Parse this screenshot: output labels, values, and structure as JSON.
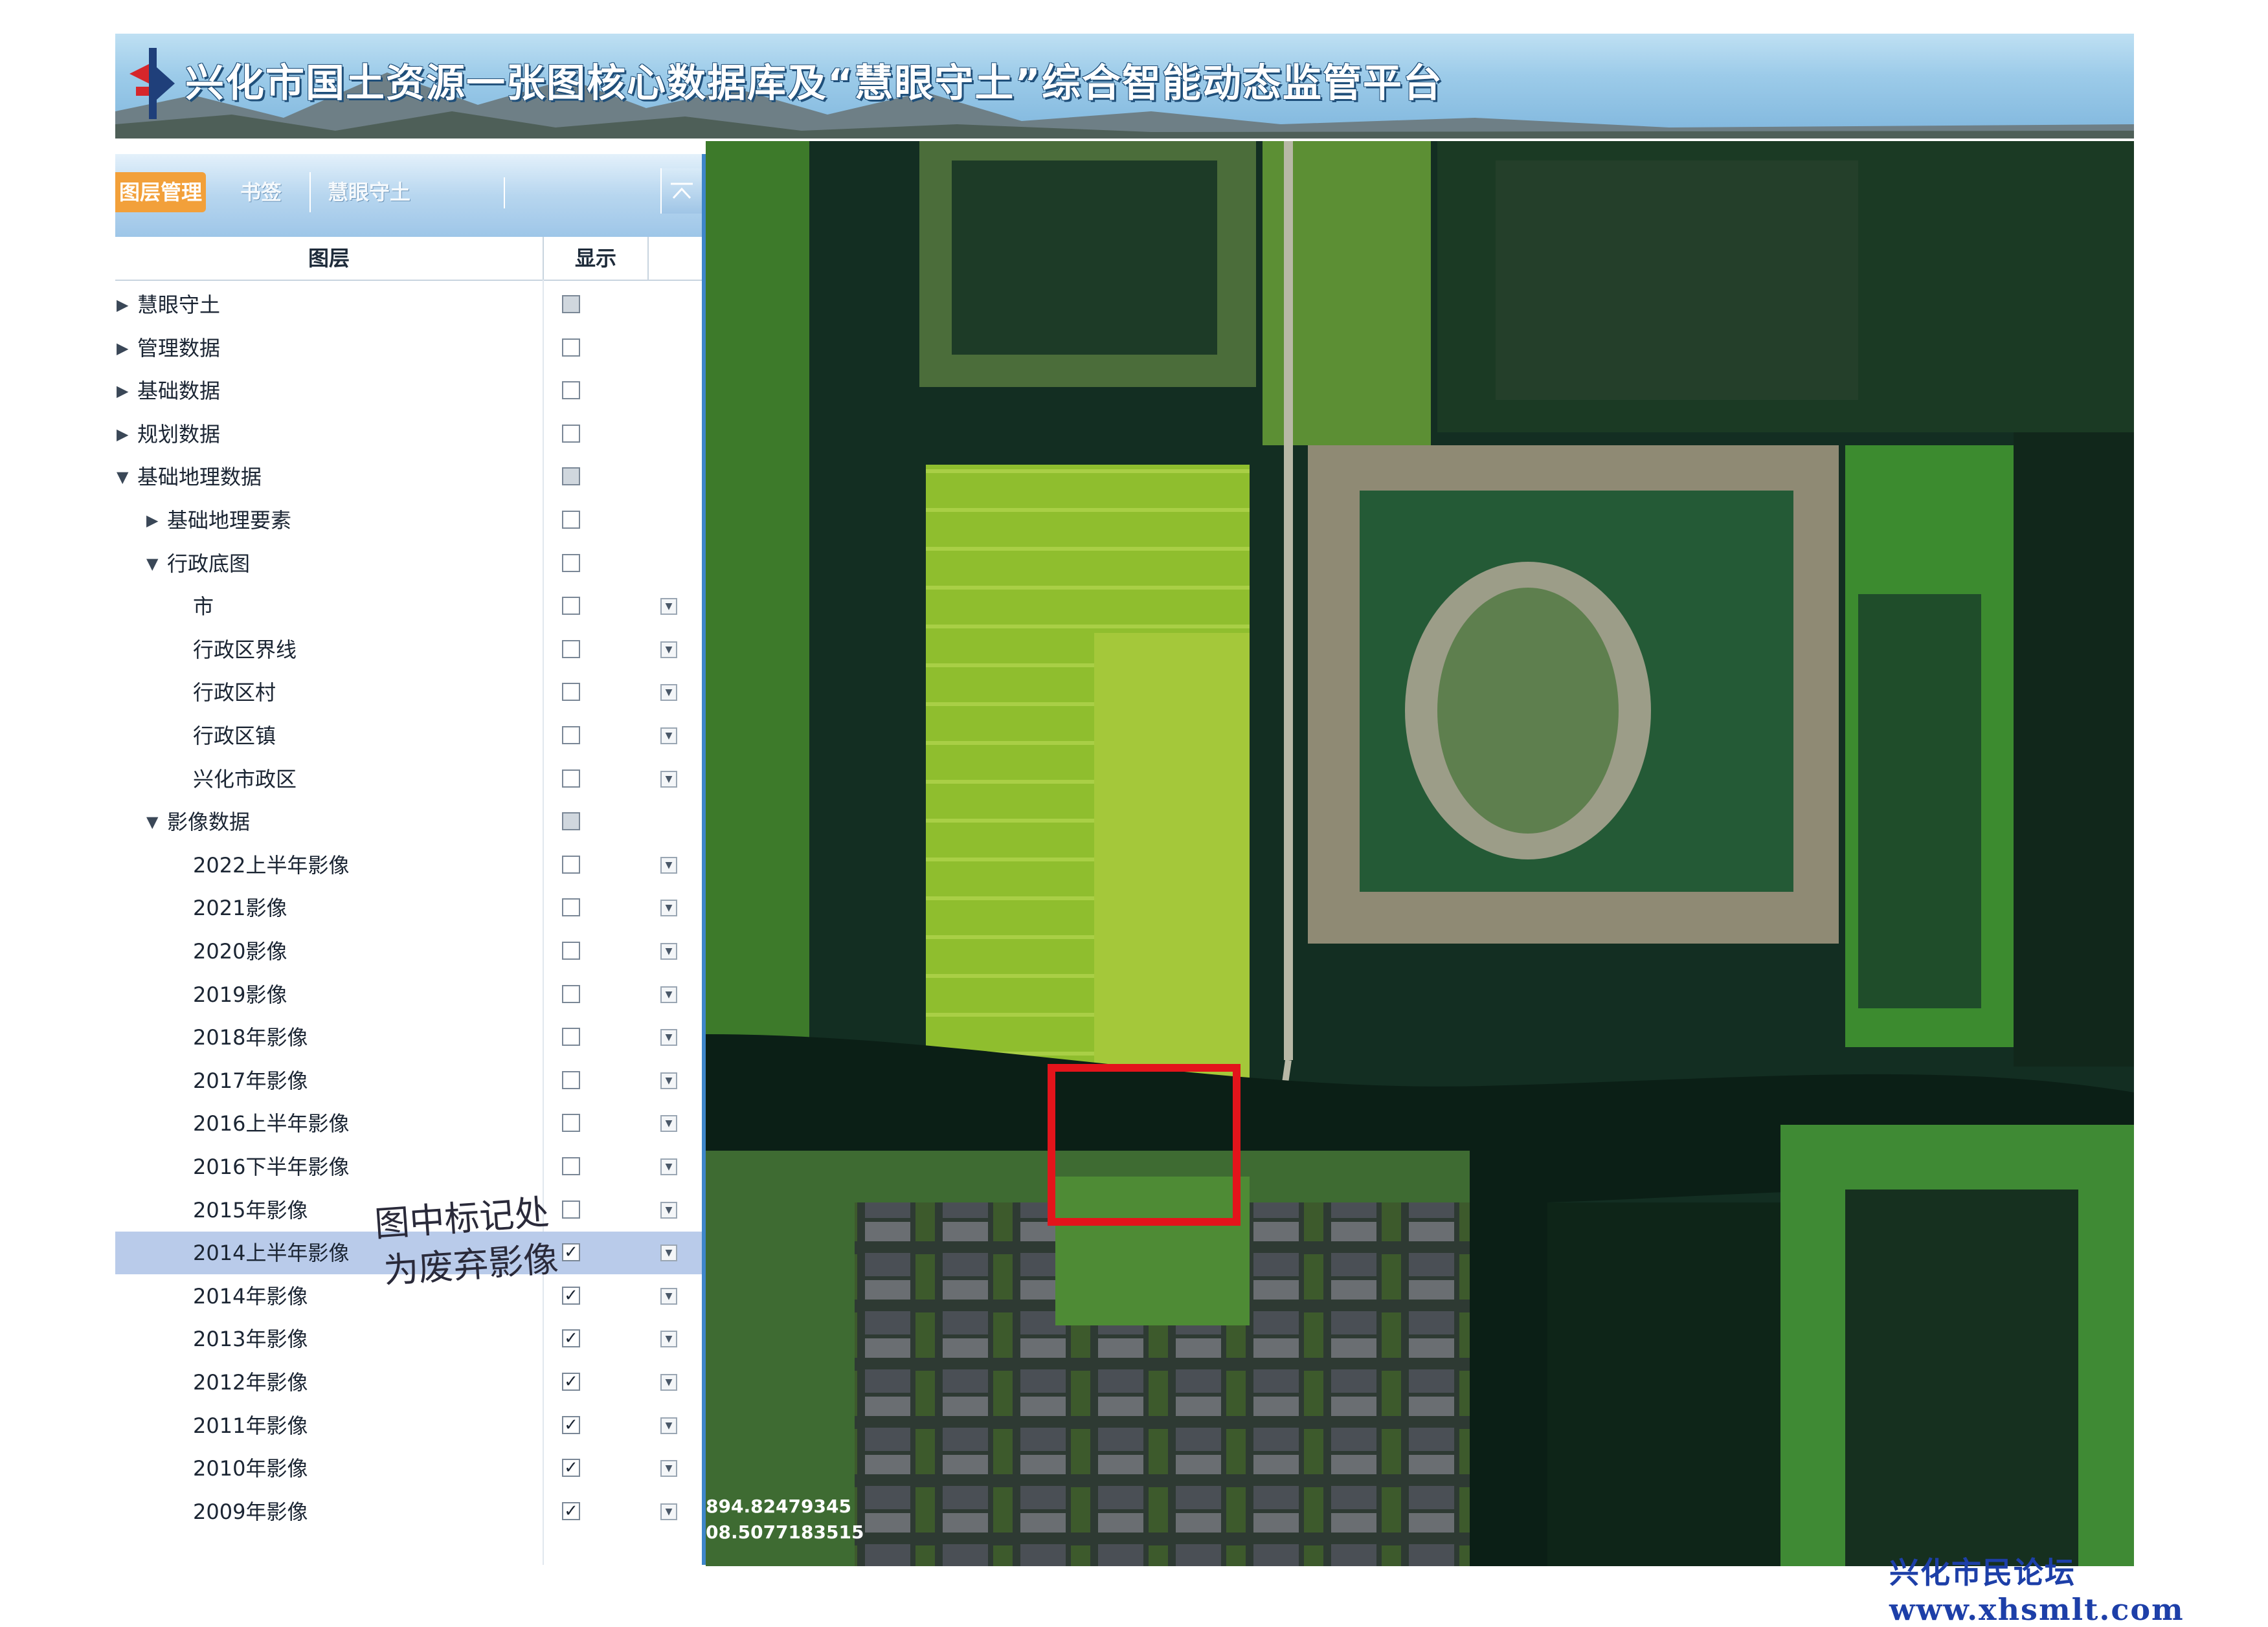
{
  "header": {
    "title": "兴化市国土资源一张图核心数据库及“慧眼守土”综合智能动态监管平台"
  },
  "tabs": [
    {
      "label": "图层管理",
      "active": true
    },
    {
      "label": "书签",
      "active": false
    },
    {
      "label": "慧眼守土",
      "active": false
    }
  ],
  "table": {
    "col_layer": "图层",
    "col_show": "显示"
  },
  "layers": [
    {
      "label": "慧眼守土",
      "level": 0,
      "expand": "collapsed",
      "check": "partial",
      "dropdown": false
    },
    {
      "label": "管理数据",
      "level": 0,
      "expand": "collapsed",
      "check": "off",
      "dropdown": false
    },
    {
      "label": "基础数据",
      "level": 0,
      "expand": "collapsed",
      "check": "off",
      "dropdown": false
    },
    {
      "label": "规划数据",
      "level": 0,
      "expand": "collapsed",
      "check": "off",
      "dropdown": false
    },
    {
      "label": "基础地理数据",
      "level": 0,
      "expand": "expanded",
      "check": "partial",
      "dropdown": false
    },
    {
      "label": "基础地理要素",
      "level": 1,
      "expand": "collapsed",
      "check": "off",
      "dropdown": false
    },
    {
      "label": "行政底图",
      "level": 1,
      "expand": "expanded",
      "check": "off",
      "dropdown": false
    },
    {
      "label": "市",
      "level": 2,
      "expand": "none",
      "check": "off",
      "dropdown": true
    },
    {
      "label": "行政区界线",
      "level": 2,
      "expand": "none",
      "check": "off",
      "dropdown": true
    },
    {
      "label": "行政区村",
      "level": 2,
      "expand": "none",
      "check": "off",
      "dropdown": true
    },
    {
      "label": "行政区镇",
      "level": 2,
      "expand": "none",
      "check": "off",
      "dropdown": true
    },
    {
      "label": "兴化市政区",
      "level": 2,
      "expand": "none",
      "check": "off",
      "dropdown": true
    },
    {
      "label": "影像数据",
      "level": 1,
      "expand": "expanded",
      "check": "partial",
      "dropdown": false
    },
    {
      "label": "2022上半年影像",
      "level": 2,
      "expand": "none",
      "check": "off",
      "dropdown": true
    },
    {
      "label": "2021影像",
      "level": 2,
      "expand": "none",
      "check": "off",
      "dropdown": true
    },
    {
      "label": "2020影像",
      "level": 2,
      "expand": "none",
      "check": "off",
      "dropdown": true
    },
    {
      "label": "2019影像",
      "level": 2,
      "expand": "none",
      "check": "off",
      "dropdown": true
    },
    {
      "label": "2018年影像",
      "level": 2,
      "expand": "none",
      "check": "off",
      "dropdown": true
    },
    {
      "label": "2017年影像",
      "level": 2,
      "expand": "none",
      "check": "off",
      "dropdown": true
    },
    {
      "label": "2016上半年影像",
      "level": 2,
      "expand": "none",
      "check": "off",
      "dropdown": true
    },
    {
      "label": "2016下半年影像",
      "level": 2,
      "expand": "none",
      "check": "off",
      "dropdown": true
    },
    {
      "label": "2015年影像",
      "level": 2,
      "expand": "none",
      "check": "off",
      "dropdown": true
    },
    {
      "label": "2014上半年影像",
      "level": 2,
      "expand": "none",
      "check": "on",
      "dropdown": true,
      "selected": true
    },
    {
      "label": "2014年影像",
      "level": 2,
      "expand": "none",
      "check": "on",
      "dropdown": true
    },
    {
      "label": "2013年影像",
      "level": 2,
      "expand": "none",
      "check": "on",
      "dropdown": true
    },
    {
      "label": "2012年影像",
      "level": 2,
      "expand": "none",
      "check": "on",
      "dropdown": true
    },
    {
      "label": "2011年影像",
      "level": 2,
      "expand": "none",
      "check": "on",
      "dropdown": true
    },
    {
      "label": "2010年影像",
      "level": 2,
      "expand": "none",
      "check": "on",
      "dropdown": true
    },
    {
      "label": "2009年影像",
      "level": 2,
      "expand": "none",
      "check": "on",
      "dropdown": true
    }
  ],
  "map": {
    "coord_line1": "894.82479345",
    "coord_line2": "08.5077183515",
    "highlight_color": "#e3141b"
  },
  "annotation": {
    "line1": "图中标记处",
    "line2": "为废弃影像"
  },
  "watermark": "兴化市民论坛 www.xhsmlt.com",
  "icons": {
    "logo": "platform-logo",
    "collapse": "collapse-up-icon",
    "expand": "triangle-icon",
    "dropdown": "chevron-down-icon"
  }
}
